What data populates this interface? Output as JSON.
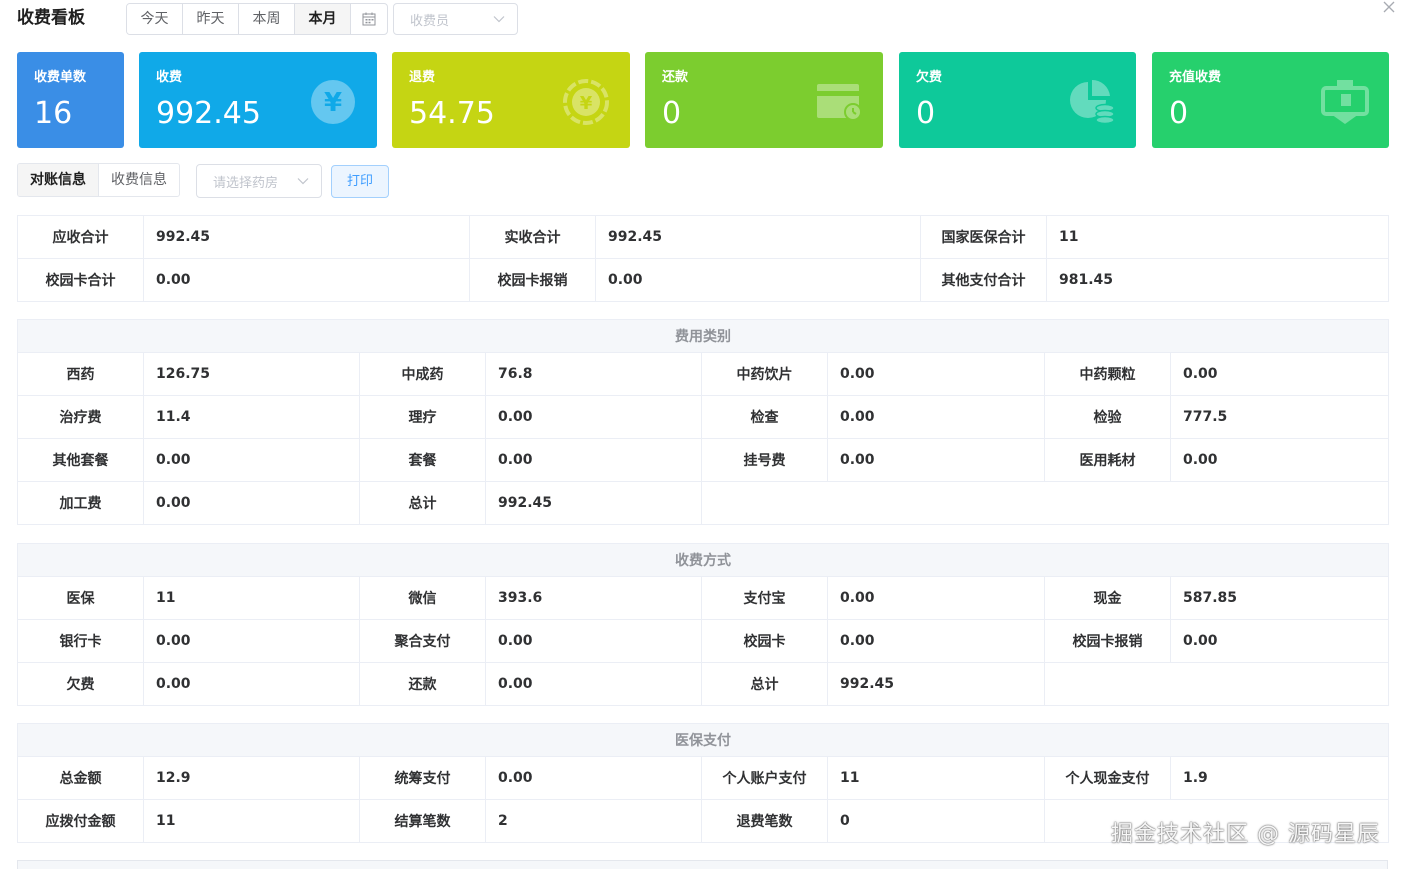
{
  "header": {
    "title": "收费看板",
    "ranges": [
      "今天",
      "昨天",
      "本周",
      "本月"
    ],
    "active_range": "本月",
    "cashier_placeholder": "收费员"
  },
  "cards": [
    {
      "label": "收费单数",
      "value": "16",
      "color": "#3a8ee6",
      "icon": "none"
    },
    {
      "label": "收费",
      "value": "992.45",
      "color": "#10a9e8",
      "icon": "yen-circle-icon"
    },
    {
      "label": "退费",
      "value": "54.75",
      "color": "#c5d513",
      "icon": "refund-coin-icon"
    },
    {
      "label": "还款",
      "value": "0",
      "color": "#7ccd2f",
      "icon": "wallet-icon"
    },
    {
      "label": "欠费",
      "value": "0",
      "color": "#0ec99a",
      "icon": "pie-coins-icon"
    },
    {
      "label": "充值收费",
      "value": "0",
      "color": "#26d06d",
      "icon": "gift-card-icon"
    }
  ],
  "tabs": [
    "对账信息",
    "收费信息"
  ],
  "active_tab": "对账信息",
  "pharmacy_placeholder": "请选择药房",
  "print_label": "打印",
  "reconciliation": [
    [
      {
        "label": "应收合计",
        "value": "992.45"
      },
      {
        "label": "实收合计",
        "value": "992.45"
      },
      {
        "label": "国家医保合计",
        "value": "11"
      }
    ],
    [
      {
        "label": "校园卡合计",
        "value": "0.00"
      },
      {
        "label": "校园卡报销",
        "value": "0.00"
      },
      {
        "label": "其他支付合计",
        "value": "981.45"
      }
    ]
  ],
  "fee_category": {
    "title": "费用类别",
    "rows": [
      [
        {
          "label": "西药",
          "value": "126.75"
        },
        {
          "label": "中成药",
          "value": "76.8"
        },
        {
          "label": "中药饮片",
          "value": "0.00"
        },
        {
          "label": "中药颗粒",
          "value": "0.00"
        }
      ],
      [
        {
          "label": "治疗费",
          "value": "11.4"
        },
        {
          "label": "理疗",
          "value": "0.00"
        },
        {
          "label": "检查",
          "value": "0.00"
        },
        {
          "label": "检验",
          "value": "777.5"
        }
      ],
      [
        {
          "label": "其他套餐",
          "value": "0.00"
        },
        {
          "label": "套餐",
          "value": "0.00"
        },
        {
          "label": "挂号费",
          "value": "0.00"
        },
        {
          "label": "医用耗材",
          "value": "0.00"
        }
      ],
      [
        {
          "label": "加工费",
          "value": "0.00"
        },
        {
          "label": "总计",
          "value": "992.45"
        }
      ]
    ]
  },
  "payment_method": {
    "title": "收费方式",
    "rows": [
      [
        {
          "label": "医保",
          "value": "11"
        },
        {
          "label": "微信",
          "value": "393.6"
        },
        {
          "label": "支付宝",
          "value": "0.00"
        },
        {
          "label": "现金",
          "value": "587.85"
        }
      ],
      [
        {
          "label": "银行卡",
          "value": "0.00"
        },
        {
          "label": "聚合支付",
          "value": "0.00"
        },
        {
          "label": "校园卡",
          "value": "0.00"
        },
        {
          "label": "校园卡报销",
          "value": "0.00"
        }
      ],
      [
        {
          "label": "欠费",
          "value": "0.00"
        },
        {
          "label": "还款",
          "value": "0.00"
        },
        {
          "label": "总计",
          "value": "992.45"
        }
      ]
    ]
  },
  "insurance": {
    "title": "医保支付",
    "rows": [
      [
        {
          "label": "总金额",
          "value": "12.9"
        },
        {
          "label": "统筹支付",
          "value": "0.00"
        },
        {
          "label": "个人账户支付",
          "value": "11"
        },
        {
          "label": "个人现金支付",
          "value": "1.9"
        }
      ],
      [
        {
          "label": "应拨付金额",
          "value": "11"
        },
        {
          "label": "结算笔数",
          "value": "2"
        },
        {
          "label": "退费笔数",
          "value": "0"
        }
      ]
    ]
  },
  "watermark": "掘金技术社区 @ 源码星辰"
}
